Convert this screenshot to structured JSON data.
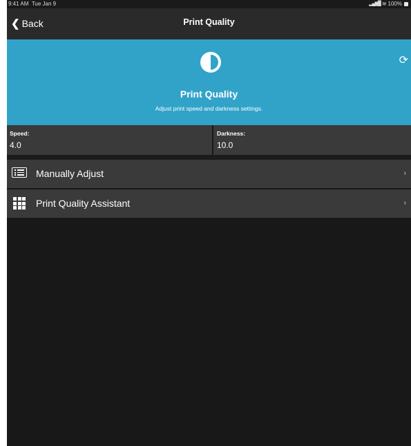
{
  "status_bar": {
    "time": "9:41 AM",
    "date": "Tue Jan 9",
    "battery": "100%"
  },
  "nav": {
    "back_label": "Back",
    "title": "Print Quality"
  },
  "hero": {
    "icon": "half-circle-icon",
    "title": "Print Quality",
    "subtitle": "Adjust print speed and darkness settings.",
    "background": "#31a3c9"
  },
  "stats": {
    "speed": {
      "label": "Speed:",
      "value": "4.0"
    },
    "darkness": {
      "label": "Darkness:",
      "value": "10.0"
    }
  },
  "menu": [
    {
      "label": "Manually Adjust",
      "icon": "list-icon",
      "chevron": "›"
    },
    {
      "label": "Print Quality Assistant",
      "icon": "grid-icon",
      "chevron": "›"
    }
  ],
  "colors": {
    "navbar": "#2a2a2a",
    "row": "#3a3a3a",
    "background": "#181818"
  }
}
